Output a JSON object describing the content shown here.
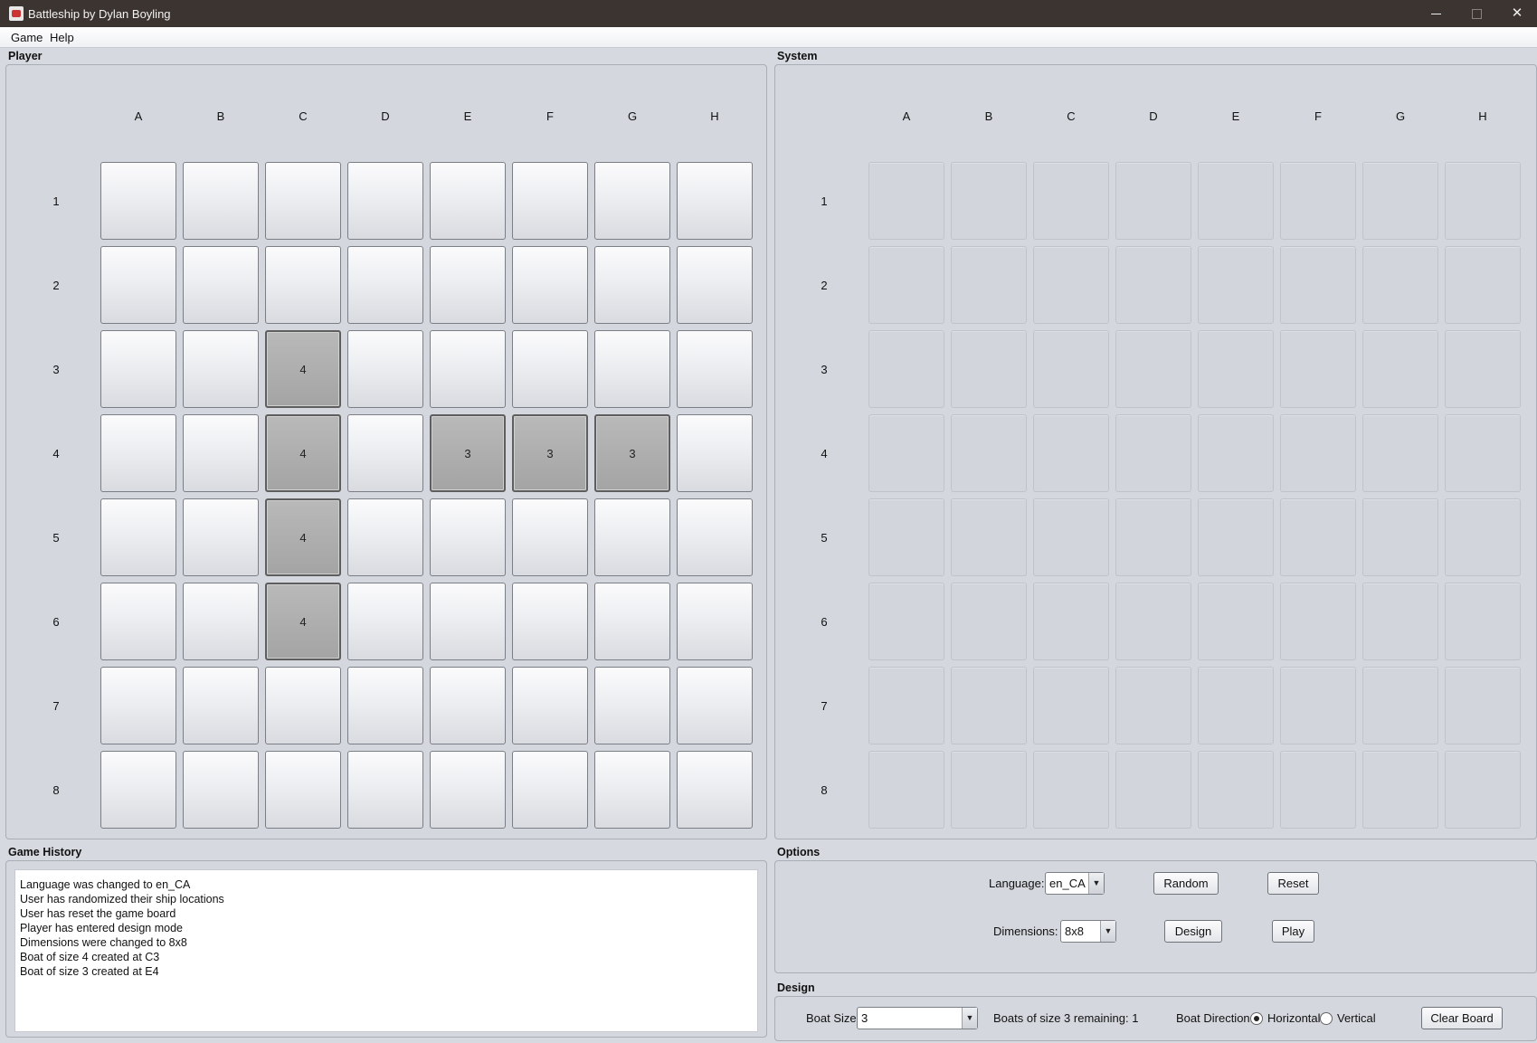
{
  "window": {
    "title": "Battleship by Dylan Boyling"
  },
  "menu": {
    "game": "Game",
    "help": "Help"
  },
  "player_panel": {
    "title": "Player",
    "columns": [
      "A",
      "B",
      "C",
      "D",
      "E",
      "F",
      "G",
      "H"
    ],
    "rows": [
      "1",
      "2",
      "3",
      "4",
      "5",
      "6",
      "7",
      "8"
    ],
    "grid": [
      [
        "",
        "",
        "",
        "",
        "",
        "",
        "",
        ""
      ],
      [
        "",
        "",
        "",
        "",
        "",
        "",
        "",
        ""
      ],
      [
        "",
        "",
        "4",
        "",
        "",
        "",
        "",
        ""
      ],
      [
        "",
        "",
        "4",
        "",
        "3",
        "3",
        "3",
        ""
      ],
      [
        "",
        "",
        "4",
        "",
        "",
        "",
        "",
        ""
      ],
      [
        "",
        "",
        "4",
        "",
        "",
        "",
        "",
        ""
      ],
      [
        "",
        "",
        "",
        "",
        "",
        "",
        "",
        ""
      ],
      [
        "",
        "",
        "",
        "",
        "",
        "",
        "",
        ""
      ]
    ]
  },
  "system_panel": {
    "title": "System",
    "columns": [
      "A",
      "B",
      "C",
      "D",
      "E",
      "F",
      "G",
      "H"
    ],
    "rows": [
      "1",
      "2",
      "3",
      "4",
      "5",
      "6",
      "7",
      "8"
    ]
  },
  "history": {
    "title": "Game History",
    "lines": [
      "Language was changed to en_CA",
      "User has randomized their ship locations",
      "User has reset the game board",
      "Player has entered design mode",
      "Dimensions were changed to 8x8",
      "Boat of size 4 created at C3",
      "Boat of size 3 created at E4"
    ]
  },
  "options": {
    "title": "Options",
    "language_label": "Language:",
    "language_value": "en_CA",
    "random_label": "Random",
    "reset_label": "Reset",
    "dimensions_label": "Dimensions:",
    "dimensions_value": "8x8",
    "design_label": "Design",
    "play_label": "Play"
  },
  "design": {
    "title": "Design",
    "boat_size_label": "Boat Size:",
    "boat_size_value": "3",
    "boats_remaining": "Boats of size 3 remaining: 1",
    "direction_label": "Boat Direction:",
    "horizontal_label": "Horizontal",
    "vertical_label": "Vertical",
    "direction_selected": "Horizontal",
    "clear_label": "Clear Board"
  }
}
